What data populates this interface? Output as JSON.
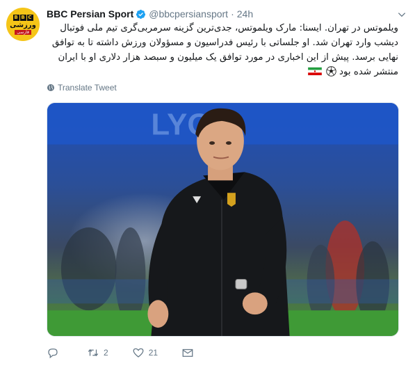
{
  "account": {
    "name": "BBC Persian Sport",
    "handle": "@bbcpersiansport",
    "separator": "·",
    "time": "24h",
    "avatar": {
      "logo": [
        "B",
        "B",
        "C"
      ],
      "arabic_text": "ورزشی",
      "tag": "فارسی"
    }
  },
  "tweet": {
    "lines": [
      "ویلموتس در تهران. ایسنا: مارک ویلموتس، جدی‌ترین گزینه سرمربی‌گری تیم ملی فوتبال",
      "دیشب وارد تهران شد. او جلساتی با رئیس فدراسیون و مسؤولان ورزش داشته تا به توافق",
      "نهایی برسد. پیش از این اخباری در مورد توافق یک میلیون و سبصد هزار دلاری او با ایران",
      "منتشر شده بود"
    ],
    "translate_label": "Translate Tweet"
  },
  "media": {
    "banner_text": "LYON"
  },
  "actions": {
    "reply_count": "",
    "retweet_count": "2",
    "like_count": "21"
  },
  "icons": [
    "verified-icon",
    "caret-down-icon",
    "globe-icon",
    "reply-icon",
    "retweet-icon",
    "like-icon",
    "dm-icon",
    "iran-flag-icon",
    "soccer-ball-icon"
  ],
  "colors": {
    "verified": "#1da1f2",
    "secondary_text": "#657786",
    "primary_text": "#14171a",
    "avatar_bg": "#f5c518"
  }
}
